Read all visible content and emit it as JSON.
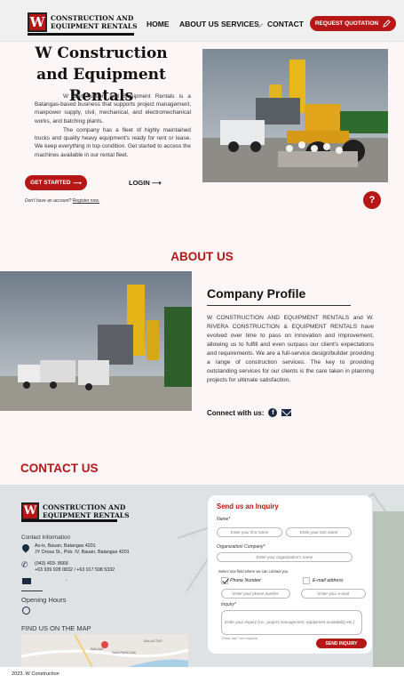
{
  "header": {
    "logo_letter": "W",
    "logo_line1": "CONSTRUCTION AND",
    "logo_line2": "EQUIPMENT RENTALS",
    "nav": {
      "home": "HOME",
      "about": "ABOUT US",
      "services": "SERVICES",
      "contact": "CONTACT"
    },
    "cta_label": "REQUEST QUOTATION"
  },
  "hero": {
    "title": "W Construction and Equipment Rentals",
    "paragraph1": "W Construction and Equipment Rentals is a Batangas-based business that supports project management, manpower supply, civil, mechanical, and electromechanical works, and batching plants.",
    "paragraph2": "The company has a fleet of highly maintained trucks and quality heavy equipment's ready for rent or lease. We keep everything in top condition. Get started to access the machines available in our rental fleet.",
    "get_started_label": "GET STARTED",
    "login_label": "LOGIN",
    "no_account_text": "Don't have an account?",
    "register_link": "Register now."
  },
  "help_button": "?",
  "about": {
    "heading": "ABOUT US",
    "profile_title": "Company Profile",
    "profile_text": "W CONSTRUCTION AND EQUIPMENT RENTALS and W. RIVERA CONSTRUCTION & EQUIPMENT RENTALS have evolved over time to pass on innovation and improvement, allowing us to fulfill and even surpass our client's expectations and requirements. We are a full-service design/builder providing a range of construction services. The key to providing outstanding services for our clients is the care taken in planning projects for ultimate satisfaction.",
    "connect_label": "Connect with us:",
    "facebook_glyph": "f"
  },
  "contact": {
    "heading": "CONTACT US",
    "info_title": "Contact Information",
    "address_line1": "As-is, Bauan, Batangas 4201",
    "address_line2": "JY Orosa St., Pob. IV, Bauan, Batangas 4201",
    "phone_line1": "(043) 403- 8668",
    "phone_line2": "+63 939 928 0832 / +63 917 508 5332",
    "email": "-",
    "hours_title": "Opening Hours",
    "map_title": "FIND US ON THE MAP",
    "map_labels": {
      "a": "BALAGTAS",
      "b": "BAUAN",
      "c": "SAN PASCUAL"
    }
  },
  "form": {
    "title": "Send us an Inquiry",
    "name_label": "Name*",
    "first_name_placeholder": "Enter your first name",
    "last_name_placeholder": "Enter your last name",
    "org_label": "Organization/ Company*",
    "org_placeholder": "Enter your organization's name",
    "contact_field_label": "Select one field where we can contact you.",
    "option_phone": "Phone Number",
    "option_email": "E-mail address",
    "phone_placeholder": "Enter your phone number",
    "email_placeholder": "Enter your e-mail",
    "inquiry_label": "Inquiry*",
    "inquiry_placeholder": "Enter your inquiry (i.e., project management, equipment availability etc.)",
    "required_note": "Fields with * are required.",
    "send_label": "SEND INQUIRY"
  },
  "footer": {
    "text": "2023. W Construction"
  },
  "colors": {
    "accent": "#b71616",
    "dark": "#111111",
    "navy": "#1b2a44"
  }
}
